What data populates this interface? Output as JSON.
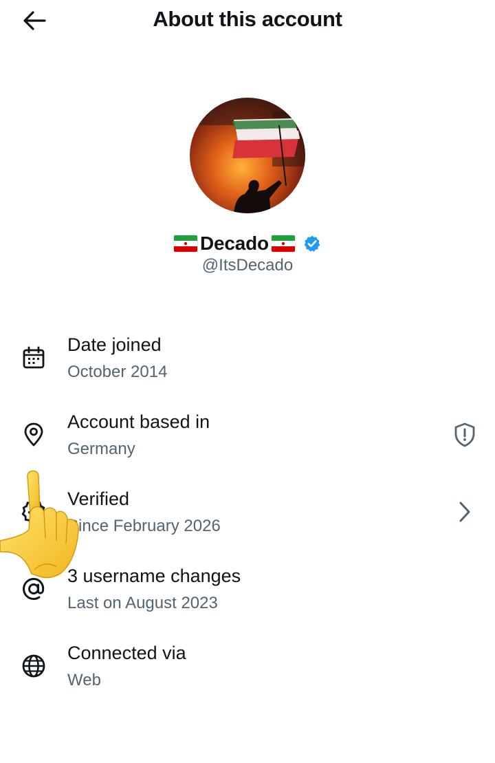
{
  "header": {
    "title": "About this account",
    "back_icon": "arrow-left-icon"
  },
  "profile": {
    "display_name": "Decado",
    "flag_icon": "iran-flag-icon",
    "handle": "@ItsDecado",
    "verified_icon": "verified-badge-icon",
    "verified_color": "#1d9bf0"
  },
  "rows": [
    {
      "icon": "calendar-icon",
      "label": "Date joined",
      "sub": "October 2014"
    },
    {
      "icon": "location-pin-icon",
      "label": "Account based in",
      "sub": "Germany",
      "right_icon": "shield-alert-icon"
    },
    {
      "icon": "verified-outline-icon",
      "label": "Verified",
      "sub": "Since February 2026",
      "right_icon": "chevron-right-icon"
    },
    {
      "icon": "at-sign-icon",
      "label": "3 username changes",
      "sub": "Last on August 2023"
    },
    {
      "icon": "globe-icon",
      "label": "Connected via",
      "sub": "Web"
    }
  ],
  "colors": {
    "text_primary": "#0f1419",
    "text_secondary": "#536471",
    "accent": "#1d9bf0"
  }
}
